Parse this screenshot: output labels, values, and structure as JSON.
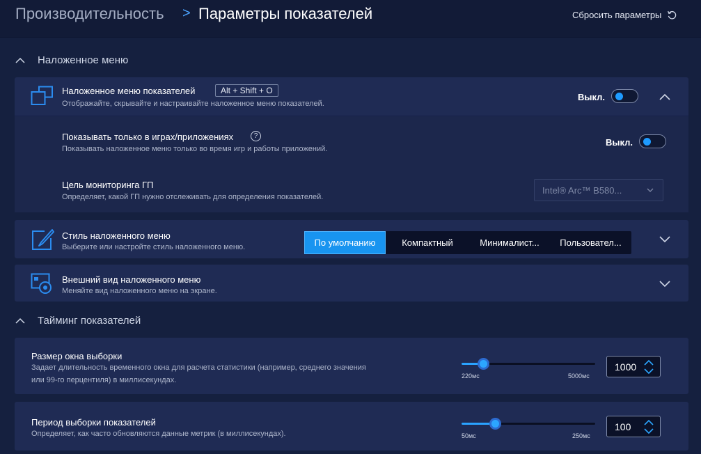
{
  "header": {
    "breadcrumb_parent": "Производительность",
    "breadcrumb_separator": ">",
    "breadcrumb_current": "Параметры показателей",
    "reset_label": "Сбросить параметры"
  },
  "sections": {
    "overlay_menu": "Наложенное меню",
    "metrics_timing": "Тайминг показателей"
  },
  "overlay": {
    "title": "Наложенное меню показателей",
    "shortcut": "Alt + Shift + O",
    "description": "Отображайте, скрывайте и настраивайте наложенное меню показателей.",
    "state": "Выкл."
  },
  "games_only": {
    "title": "Показывать только в играх/приложениях",
    "help_icon": "?",
    "description": "Показывать наложенное меню только во время игр и работы приложений.",
    "state": "Выкл."
  },
  "gpu_target": {
    "title": "Цель мониторинга ГП",
    "description": "Определяет, какой ГП нужно отслеживать для определения показателей.",
    "selected": "Intel® Arc™ B580..."
  },
  "style": {
    "title": "Стиль наложенного меню",
    "description": "Выберите или настройте стиль наложенного меню.",
    "options": [
      "По умолчанию",
      "Компактный",
      "Минималист...",
      "Пользовател..."
    ],
    "selected_index": 0
  },
  "appearance": {
    "title": "Внешний вид наложенного меню",
    "description": "Меняйте вид наложенного меню на экране."
  },
  "sample_window": {
    "title": "Размер окна выборки",
    "description_line1": "Задает длительность временного окна для расчета статистики (например, среднего значения",
    "description_line2": "или 99-го перцентиля) в миллисекундах.",
    "min_label": "220мс",
    "max_label": "5000мс",
    "min": 220,
    "max": 5000,
    "value": "1000"
  },
  "sample_period": {
    "title": "Период выборки показателей",
    "description": "Определяет, как часто обновляются данные метрик (в миллисекундах).",
    "min_label": "50мс",
    "max_label": "250мс",
    "min": 50,
    "max": 250,
    "value": "100"
  },
  "colors": {
    "background": "#15203f",
    "card": "#1f2b54",
    "accent": "#1e9bff",
    "icon": "#2b8cf0"
  },
  "icons": [
    "refresh-icon",
    "overlay-windows-icon",
    "style-brush-icon",
    "appearance-icon",
    "chevron-up-icon",
    "chevron-down-icon",
    "help-icon",
    "stepper-arrows-icon"
  ]
}
